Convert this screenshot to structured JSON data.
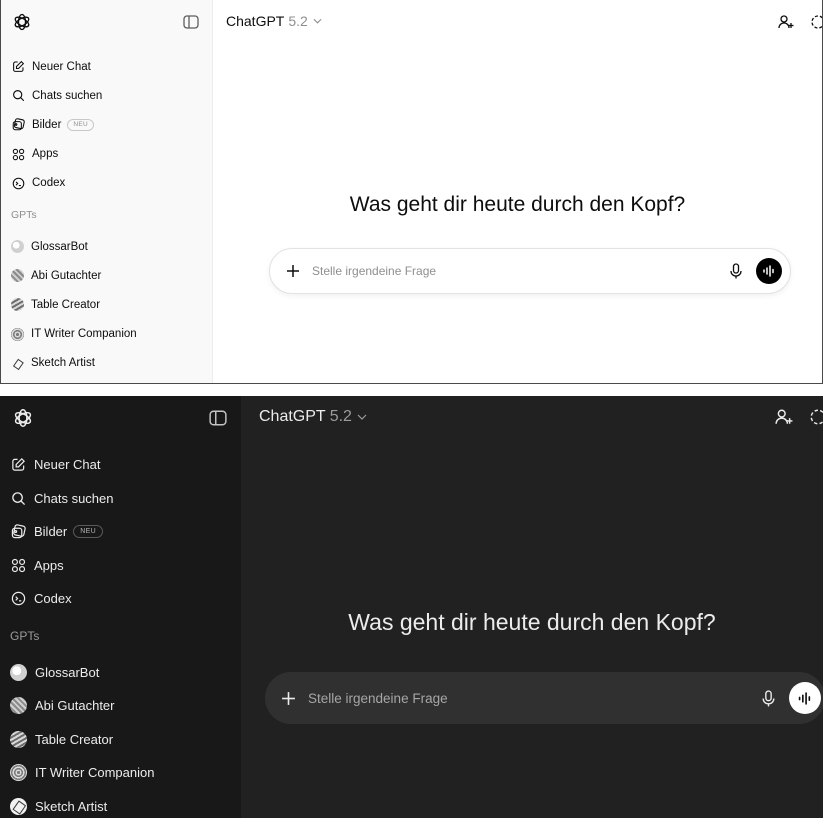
{
  "colors": {
    "light_bg": "#ffffff",
    "light_sidebar": "#f9f9f9",
    "dark_bg": "#212121",
    "dark_sidebar": "#181818",
    "dark_composer": "#303030"
  },
  "sidebar": {
    "nav": [
      {
        "label": "Neuer Chat",
        "icon": "edit-icon"
      },
      {
        "label": "Chats suchen",
        "icon": "search-icon"
      },
      {
        "label": "Bilder",
        "icon": "image-icon",
        "badge": "NEU"
      },
      {
        "label": "Apps",
        "icon": "apps-icon"
      },
      {
        "label": "Codex",
        "icon": "codex-icon"
      }
    ],
    "section_label": "GPTs",
    "gpts": [
      {
        "label": "GlossarBot"
      },
      {
        "label": "Abi Gutachter"
      },
      {
        "label": "Table Creator"
      },
      {
        "label": "IT Writer Companion"
      },
      {
        "label": "Sketch Artist"
      }
    ]
  },
  "header": {
    "model_name": "ChatGPT",
    "model_version": "5.2"
  },
  "main": {
    "heading": "Was geht dir heute durch den Kopf?"
  },
  "composer": {
    "placeholder": "Stelle irgendeine Frage"
  }
}
